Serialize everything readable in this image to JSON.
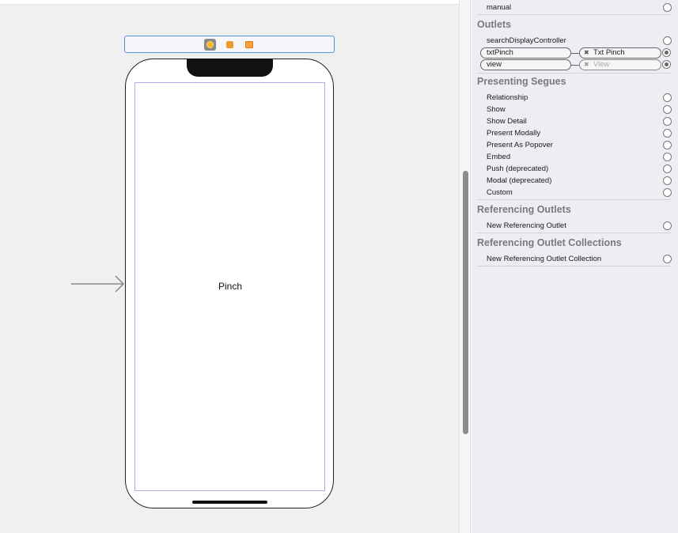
{
  "canvas": {
    "view_label": "Pinch"
  },
  "inspector": {
    "triggered": {
      "manual_label": "manual"
    },
    "outlets": {
      "title": "Outlets",
      "search_display_controller": "searchDisplayController",
      "connections": [
        {
          "source": "txtPinch",
          "target": "Txt Pinch"
        },
        {
          "source": "view",
          "target": "View"
        }
      ]
    },
    "presenting_segues": {
      "title": "Presenting Segues",
      "items": [
        "Relationship",
        "Show",
        "Show Detail",
        "Present Modally",
        "Present As Popover",
        "Embed",
        "Push (deprecated)",
        "Modal (deprecated)",
        "Custom"
      ]
    },
    "referencing_outlets": {
      "title": "Referencing Outlets",
      "new_label": "New Referencing Outlet"
    },
    "referencing_outlet_collections": {
      "title": "Referencing Outlet Collections",
      "new_label": "New Referencing Outlet Collection"
    }
  },
  "colors": {
    "safe_area_outline": "#b3a9e6",
    "selection_outline": "#5a8fd6",
    "inspector_bg": "#f0ecf3"
  },
  "icons": [
    "view-controller-icon",
    "first-responder-icon",
    "exit-icon",
    "remove-connection-icon",
    "connection-circle-icon",
    "entry-point-arrow-icon"
  ]
}
